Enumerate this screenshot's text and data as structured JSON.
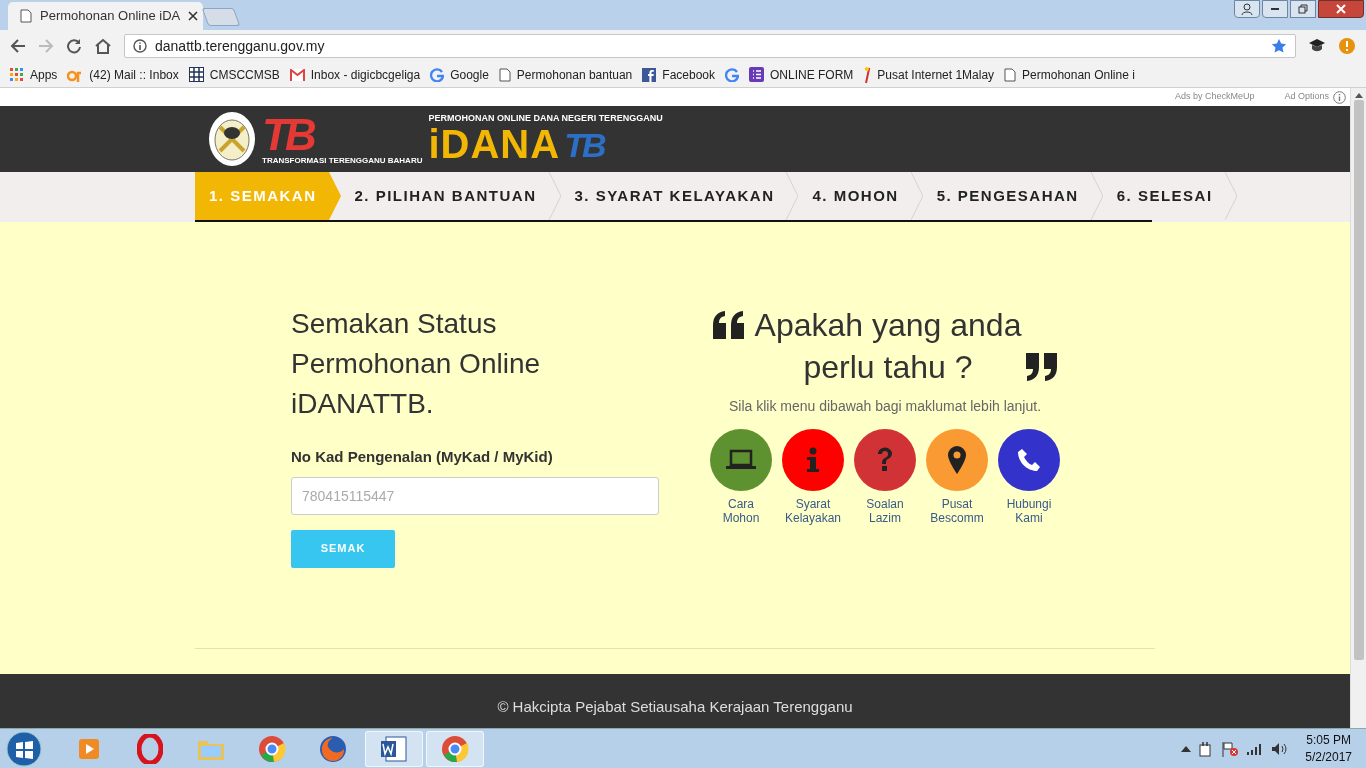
{
  "browser": {
    "tabs": [
      {
        "title": "Permohonan Online iDA",
        "selected": true
      }
    ],
    "url": "danattb.terengganu.gov.my",
    "bookmarks": [
      {
        "kind": "apps",
        "label": "Apps"
      },
      {
        "kind": "cp",
        "label": "(42) Mail :: Inbox"
      },
      {
        "kind": "grid",
        "label": "CMSCCMSB"
      },
      {
        "kind": "gmail",
        "label": "Inbox - digicbcgeliga"
      },
      {
        "kind": "google",
        "label": "Google"
      },
      {
        "kind": "page",
        "label": "Permohonan bantuan"
      },
      {
        "kind": "facebook",
        "label": "Facebook"
      },
      {
        "kind": "google"
      },
      {
        "kind": "form",
        "label": "ONLINE FORM"
      },
      {
        "kind": "flag",
        "label": "Pusat Internet 1Malay"
      },
      {
        "kind": "page",
        "label": "Permohonan Online i"
      }
    ]
  },
  "ad_bar": {
    "label": "Ads by CheckMeUp",
    "options": "Ad Options"
  },
  "header": {
    "logo_mark": "TB",
    "logo_tagline": "TRANSFORMASI TERENGGANU BAHARU",
    "title_small": "PERMOHONAN ONLINE DANA NEGERI TERENGGANU",
    "title_big": "iDANA",
    "title_mark": "TB"
  },
  "steps": [
    {
      "label": "1. SEMAKAN",
      "selected": true
    },
    {
      "label": "2. PILIHAN BANTUAN",
      "selected": false
    },
    {
      "label": "3. SYARAT KELAYAKAN",
      "selected": false
    },
    {
      "label": "4. MOHON",
      "selected": false
    },
    {
      "label": "5. PENGESAHAN",
      "selected": false
    },
    {
      "label": "6. SELESAI",
      "selected": false
    }
  ],
  "form": {
    "heading": "Semakan Status Permohonan Online iDANATTB.",
    "label": "No Kad Pengenalan (MyKad / MyKid)",
    "placeholder": "780415115447",
    "button": "SEMAK"
  },
  "info": {
    "heading": "Apakah yang anda perlu tahu ?",
    "subtitle": "Sila klik menu dibawah bagi maklumat lebih lanjut.",
    "items": [
      {
        "kind": "laptop",
        "color": "#5e9130",
        "label": "Cara Mohon"
      },
      {
        "kind": "info",
        "color": "#ff0000",
        "label": "Syarat Kelayakan"
      },
      {
        "kind": "question",
        "color": "#d13236",
        "label": "Soalan Lazim"
      },
      {
        "kind": "pin",
        "color": "#f99a33",
        "label": "Pusat Bescomm"
      },
      {
        "kind": "phone",
        "color": "#3333cc",
        "label": "Hubungi Kami"
      }
    ]
  },
  "footer": {
    "copyright": "© Hakcipta Pejabat Setiausaha Kerajaan Terengganu"
  },
  "taskbar": {
    "time": "5:05 PM",
    "date": "5/2/2017"
  }
}
